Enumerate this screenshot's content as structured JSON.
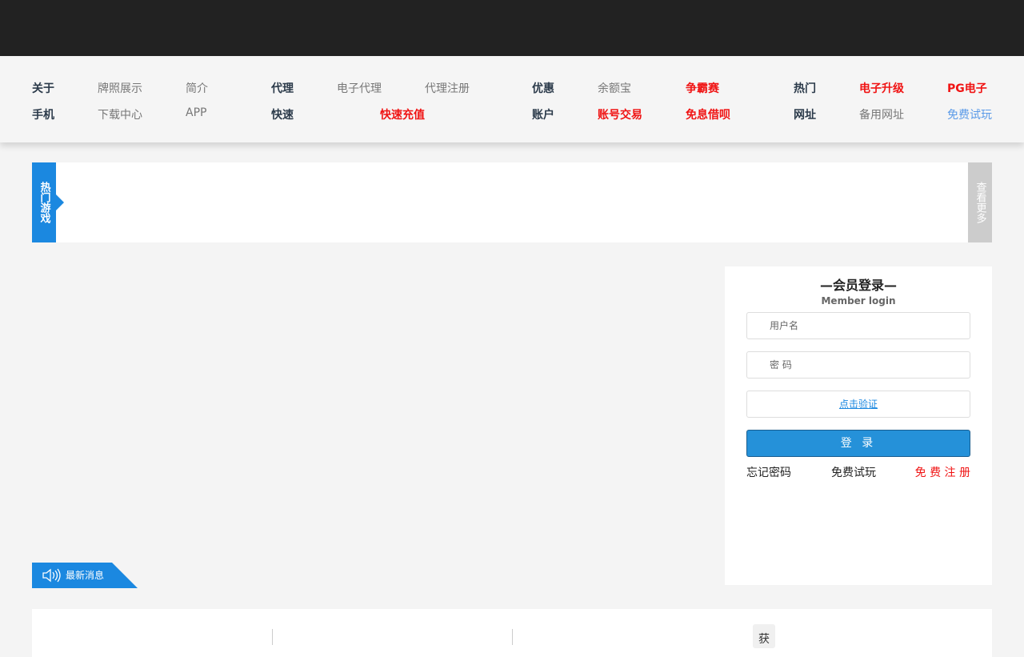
{
  "nav": {
    "row1": [
      {
        "t": "关于",
        "c": "h"
      },
      {
        "t": "牌照展示",
        "c": "g"
      },
      {
        "t": "简介",
        "c": "g"
      },
      {
        "t": "代理",
        "c": "h"
      },
      {
        "t": "电子代理",
        "c": "g"
      },
      {
        "t": "代理注册",
        "c": "g"
      },
      {
        "t": "优惠",
        "c": "h"
      },
      {
        "t": "余额宝",
        "c": "g"
      },
      {
        "t": "争霸赛",
        "c": "r"
      },
      {
        "t": "热门",
        "c": "h"
      },
      {
        "t": "电子升级",
        "c": "r"
      },
      {
        "t": "PG电子",
        "c": "r"
      }
    ],
    "row2": [
      {
        "t": "手机",
        "c": "h"
      },
      {
        "t": "下载中心",
        "c": "g"
      },
      {
        "t": "APP",
        "c": "g"
      },
      {
        "t": "快速",
        "c": "h"
      },
      {
        "t": "快速充值",
        "c": "r"
      },
      {
        "t": "账户",
        "c": "h"
      },
      {
        "t": "账号交易",
        "c": "r"
      },
      {
        "t": "免息借呗",
        "c": "r"
      },
      {
        "t": "网址",
        "c": "h"
      },
      {
        "t": "备用网址",
        "c": "g"
      },
      {
        "t": "免费试玩",
        "c": "b"
      }
    ]
  },
  "strip": {
    "left_label": "热门游戏",
    "right_label": "查看更多"
  },
  "login": {
    "title": "—会员登录—",
    "subtitle": "Member login",
    "username_placeholder": "用户名",
    "password_placeholder": "密 码",
    "verify": "点击验证",
    "submit": "登 录",
    "forgot": "忘记密码",
    "trial": "免费试玩",
    "register": "免 费 注 册"
  },
  "news": {
    "label": "最新消息"
  },
  "bottom": {
    "tag": "获"
  },
  "colors": {
    "accent": "#1b88e0",
    "red": "#f01414",
    "topbar": "#222222"
  }
}
